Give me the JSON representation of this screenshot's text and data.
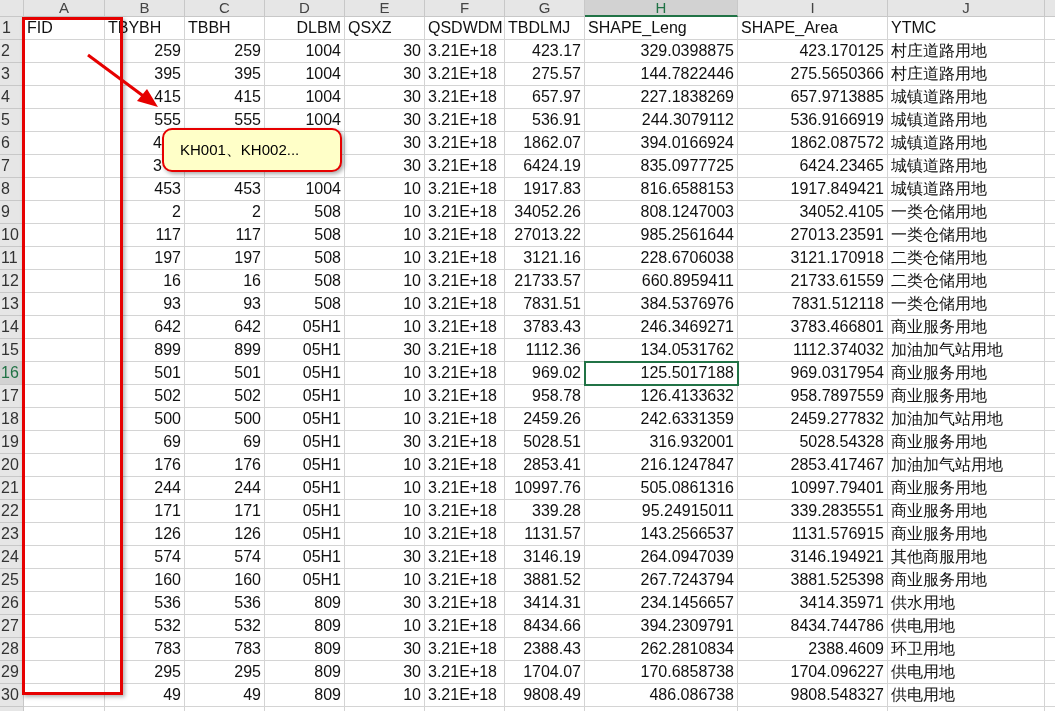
{
  "columns": [
    {
      "letter": "A",
      "selected": false,
      "kind": "text"
    },
    {
      "letter": "B",
      "selected": false,
      "kind": "number"
    },
    {
      "letter": "C",
      "selected": false,
      "kind": "number"
    },
    {
      "letter": "D",
      "selected": false,
      "kind": "number"
    },
    {
      "letter": "E",
      "selected": false,
      "kind": "number"
    },
    {
      "letter": "F",
      "selected": false,
      "kind": "text"
    },
    {
      "letter": "G",
      "selected": false,
      "kind": "number"
    },
    {
      "letter": "H",
      "selected": true,
      "kind": "number"
    },
    {
      "letter": "I",
      "selected": false,
      "kind": "number"
    },
    {
      "letter": "J",
      "selected": false,
      "kind": "text"
    }
  ],
  "field_row": {
    "number": "1",
    "selected": false,
    "cells": [
      {
        "text": "FID",
        "kind": "text"
      },
      {
        "text": "TBYBH",
        "kind": "text"
      },
      {
        "text": "TBBH",
        "kind": "text"
      },
      {
        "text": "DLBM",
        "kind": "number"
      },
      {
        "text": "QSXZ",
        "kind": "text"
      },
      {
        "text": "QSDWDM",
        "kind": "text"
      },
      {
        "text": "TBDLMJ",
        "kind": "text"
      },
      {
        "text": "SHAPE_Leng",
        "kind": "text"
      },
      {
        "text": "SHAPE_Area",
        "kind": "text"
      },
      {
        "text": "YTMC",
        "kind": "text"
      }
    ]
  },
  "rows": [
    {
      "number": "2",
      "selected": false,
      "cells": [
        null,
        "259",
        "259",
        "1004",
        "30",
        "3.21E+18",
        "423.17",
        "329.0398875",
        "423.170125",
        "村庄道路用地"
      ]
    },
    {
      "number": "3",
      "selected": false,
      "cells": [
        null,
        "395",
        "395",
        "1004",
        "30",
        "3.21E+18",
        "275.57",
        "144.7822446",
        "275.5650366",
        "村庄道路用地"
      ]
    },
    {
      "number": "4",
      "selected": false,
      "cells": [
        null,
        "415",
        "415",
        "1004",
        "30",
        "3.21E+18",
        "657.97",
        "227.1838269",
        "657.9713885",
        "城镇道路用地"
      ]
    },
    {
      "number": "5",
      "selected": false,
      "cells": [
        null,
        "555",
        "555",
        "1004",
        "30",
        "3.21E+18",
        "536.91",
        "244.3079112",
        "536.9166919",
        "城镇道路用地"
      ]
    },
    {
      "number": "6",
      "selected": false,
      "cells": [
        null,
        {
          "text": "4",
          "kind": "clipped"
        },
        null,
        null,
        "30",
        "3.21E+18",
        "1862.07",
        "394.0166924",
        "1862.087572",
        "城镇道路用地"
      ]
    },
    {
      "number": "7",
      "selected": false,
      "cells": [
        null,
        {
          "text": "3",
          "kind": "clipped"
        },
        null,
        null,
        "30",
        "3.21E+18",
        "6424.19",
        "835.0977725",
        "6424.23465",
        "城镇道路用地"
      ]
    },
    {
      "number": "8",
      "selected": false,
      "cells": [
        null,
        "453",
        "453",
        "1004",
        "10",
        "3.21E+18",
        "1917.83",
        "816.6588153",
        "1917.849421",
        "城镇道路用地"
      ]
    },
    {
      "number": "9",
      "selected": false,
      "cells": [
        null,
        "2",
        "2",
        "508",
        "10",
        "3.21E+18",
        "34052.26",
        "808.1247003",
        "34052.4105",
        "一类仓储用地"
      ]
    },
    {
      "number": "10",
      "selected": false,
      "cells": [
        null,
        "117",
        "117",
        "508",
        "10",
        "3.21E+18",
        "27013.22",
        "985.2561644",
        "27013.23591",
        "一类仓储用地"
      ]
    },
    {
      "number": "11",
      "selected": false,
      "cells": [
        null,
        "197",
        "197",
        "508",
        "10",
        "3.21E+18",
        "3121.16",
        "228.6706038",
        "3121.170918",
        "二类仓储用地"
      ]
    },
    {
      "number": "12",
      "selected": false,
      "cells": [
        null,
        "16",
        "16",
        "508",
        "10",
        "3.21E+18",
        "21733.57",
        "660.8959411",
        "21733.61559",
        "二类仓储用地"
      ]
    },
    {
      "number": "13",
      "selected": false,
      "cells": [
        null,
        "93",
        "93",
        "508",
        "10",
        "3.21E+18",
        "7831.51",
        "384.5376976",
        "7831.512118",
        "一类仓储用地"
      ]
    },
    {
      "number": "14",
      "selected": false,
      "cells": [
        null,
        "642",
        "642",
        "05H1",
        "10",
        "3.21E+18",
        "3783.43",
        "246.3469271",
        "3783.466801",
        "商业服务用地"
      ]
    },
    {
      "number": "15",
      "selected": false,
      "cells": [
        null,
        "899",
        "899",
        "05H1",
        "30",
        "3.21E+18",
        "1112.36",
        "134.0531762",
        "1112.374032",
        "加油加气站用地"
      ]
    },
    {
      "number": "16",
      "selected": true,
      "cells": [
        null,
        "501",
        "501",
        "05H1",
        "10",
        "3.21E+18",
        "969.02",
        {
          "text": "125.5017188",
          "selected": true
        },
        "969.0317954",
        "商业服务用地"
      ]
    },
    {
      "number": "17",
      "selected": false,
      "cells": [
        null,
        "502",
        "502",
        "05H1",
        "10",
        "3.21E+18",
        "958.78",
        "126.4133632",
        "958.7897559",
        "商业服务用地"
      ]
    },
    {
      "number": "18",
      "selected": false,
      "cells": [
        null,
        "500",
        "500",
        "05H1",
        "10",
        "3.21E+18",
        "2459.26",
        "242.6331359",
        "2459.277832",
        "加油加气站用地"
      ]
    },
    {
      "number": "19",
      "selected": false,
      "cells": [
        null,
        "69",
        "69",
        "05H1",
        "30",
        "3.21E+18",
        "5028.51",
        "316.932001",
        "5028.54328",
        "商业服务用地"
      ]
    },
    {
      "number": "20",
      "selected": false,
      "cells": [
        null,
        "176",
        "176",
        "05H1",
        "10",
        "3.21E+18",
        "2853.41",
        "216.1247847",
        "2853.417467",
        "加油加气站用地"
      ]
    },
    {
      "number": "21",
      "selected": false,
      "cells": [
        null,
        "244",
        "244",
        "05H1",
        "10",
        "3.21E+18",
        "10997.76",
        "505.0861316",
        "10997.79401",
        "商业服务用地"
      ]
    },
    {
      "number": "22",
      "selected": false,
      "cells": [
        null,
        "171",
        "171",
        "05H1",
        "10",
        "3.21E+18",
        "339.28",
        "95.24915011",
        "339.2835551",
        "商业服务用地"
      ]
    },
    {
      "number": "23",
      "selected": false,
      "cells": [
        null,
        "126",
        "126",
        "05H1",
        "10",
        "3.21E+18",
        "1131.57",
        "143.2566537",
        "1131.576915",
        "商业服务用地"
      ]
    },
    {
      "number": "24",
      "selected": false,
      "cells": [
        null,
        "574",
        "574",
        "05H1",
        "30",
        "3.21E+18",
        "3146.19",
        "264.0947039",
        "3146.194921",
        "其他商服用地"
      ]
    },
    {
      "number": "25",
      "selected": false,
      "cells": [
        null,
        "160",
        "160",
        "05H1",
        "10",
        "3.21E+18",
        "3881.52",
        "267.7243794",
        "3881.525398",
        "商业服务用地"
      ]
    },
    {
      "number": "26",
      "selected": false,
      "cells": [
        null,
        "536",
        "536",
        "809",
        "30",
        "3.21E+18",
        "3414.31",
        "234.1456657",
        "3414.35971",
        "供水用地"
      ]
    },
    {
      "number": "27",
      "selected": false,
      "cells": [
        null,
        "532",
        "532",
        "809",
        "10",
        "3.21E+18",
        "8434.66",
        "394.2309791",
        "8434.744786",
        "供电用地"
      ]
    },
    {
      "number": "28",
      "selected": false,
      "cells": [
        null,
        "783",
        "783",
        "809",
        "30",
        "3.21E+18",
        "2388.43",
        "262.2810834",
        "2388.4609",
        "环卫用地"
      ]
    },
    {
      "number": "29",
      "selected": false,
      "cells": [
        null,
        "295",
        "295",
        "809",
        "30",
        "3.21E+18",
        "1704.07",
        "170.6858738",
        "1704.096227",
        "供电用地"
      ]
    },
    {
      "number": "30",
      "selected": false,
      "cells": [
        null,
        "49",
        "49",
        "809",
        "10",
        "3.21E+18",
        "9808.49",
        "486.086738",
        "9808.548327",
        "供电用地"
      ]
    }
  ],
  "callout": {
    "text": "KH001、KH002..."
  }
}
